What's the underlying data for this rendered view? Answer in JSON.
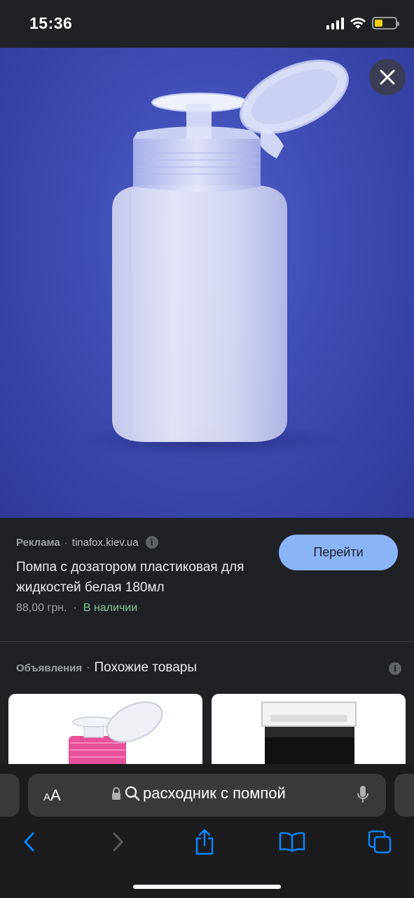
{
  "status_bar": {
    "time": "15:36",
    "icons": [
      "cellular-signal-icon",
      "wifi-icon",
      "battery-icon"
    ],
    "battery_level_pct": 40,
    "battery_color": "#f5d10a"
  },
  "hero": {
    "background_color": "#3e4cb4",
    "image_subject": "bottle-with-pump-dispenser",
    "close_icon": "close-icon"
  },
  "ad": {
    "label": "Реклама",
    "domain": "tinafox.kiev.ua",
    "title": "Помпа с дозатором пластиковая для жидкостей белая 180мл",
    "price": "88,00 грн.",
    "stock": "В наличии",
    "button_label": "Перейти",
    "button_color": "#8ab4f8",
    "stock_color": "#81c995"
  },
  "similar": {
    "ads_label": "Объявления",
    "title": "Похожие товары"
  },
  "browser": {
    "text_size_label_small": "A",
    "text_size_label_large": "A",
    "search_query": "расходник с помпой",
    "toolbar_icons": [
      "back-icon",
      "forward-icon",
      "share-icon",
      "bookmarks-icon",
      "tabs-icon"
    ],
    "accent": "#0a84ff"
  }
}
